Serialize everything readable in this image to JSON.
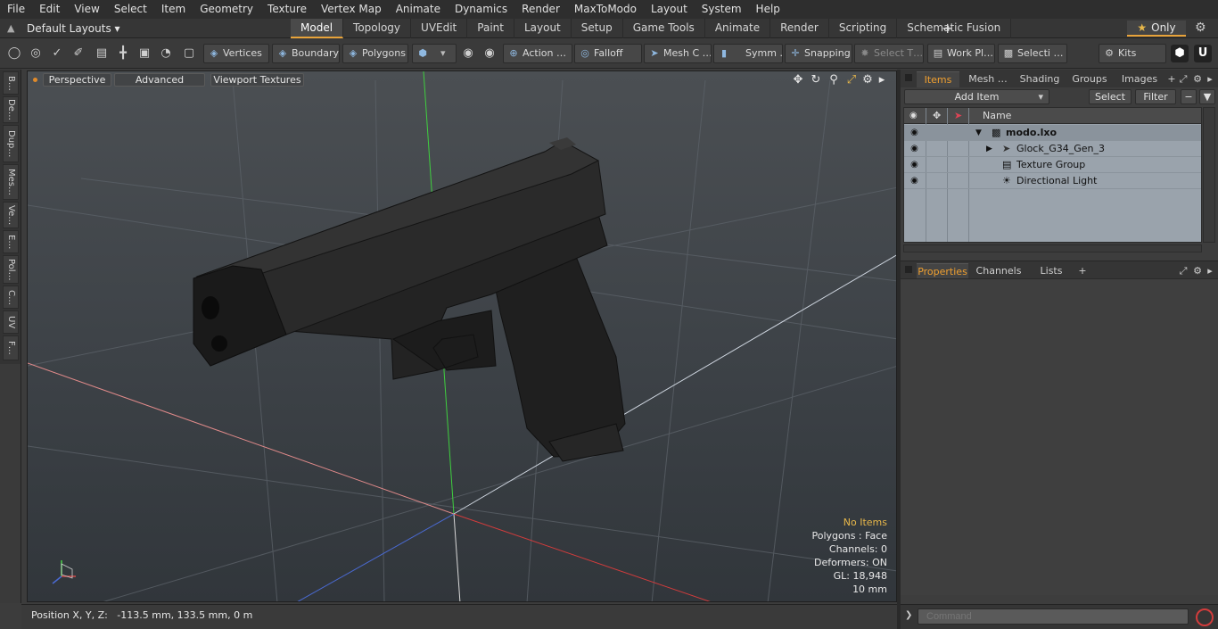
{
  "menu": [
    "File",
    "Edit",
    "View",
    "Select",
    "Item",
    "Geometry",
    "Texture",
    "Vertex Map",
    "Animate",
    "Dynamics",
    "Render",
    "MaxToModo",
    "Layout",
    "System",
    "Help"
  ],
  "layouts": {
    "label": "Default Layouts ▾"
  },
  "mode_tabs": [
    {
      "label": "Model",
      "active": true
    },
    {
      "label": "Topology"
    },
    {
      "label": "UVEdit"
    },
    {
      "label": "Paint"
    },
    {
      "label": "Layout"
    },
    {
      "label": "Setup"
    },
    {
      "label": "Game Tools"
    },
    {
      "label": "Animate"
    },
    {
      "label": "Render"
    },
    {
      "label": "Scripting"
    },
    {
      "label": "Schematic Fusion"
    }
  ],
  "add_tab": "+",
  "only_label": "Only",
  "toolbar": {
    "vertices": "Vertices",
    "boundary": "Boundary",
    "polygons": "Polygons",
    "action": "Action  …",
    "falloff": "Falloff",
    "mesh_c": "Mesh C …",
    "symm": "Symm …",
    "snapping": "Snapping",
    "select_t": "Select T…",
    "work_pl": "Work Pl…",
    "selecti": "Selecti …",
    "kits": "Kits"
  },
  "left_tabs": [
    "B…",
    "De…",
    "Dup…",
    "Mes…",
    "Ve…",
    "E…",
    "Pol…",
    "C…",
    "UV",
    "F…"
  ],
  "viewport": {
    "perspective": "Perspective",
    "advanced": "Advanced",
    "viewport_textures": "Viewport Textures",
    "info": {
      "no_items": "No Items",
      "polygons": "Polygons : Face",
      "channels": "Channels: 0",
      "deformers": "Deformers: ON",
      "gl": "GL: 18,948",
      "scale": "10 mm"
    }
  },
  "position_bar": "Position X, Y, Z:   -113.5 mm, 133.5 mm, 0 m",
  "right_panel": {
    "tabs": [
      {
        "label": "Items",
        "active": true
      },
      {
        "label": "Mesh …"
      },
      {
        "label": "Shading"
      },
      {
        "label": "Groups"
      },
      {
        "label": "Images"
      }
    ],
    "add_item": "Add Item",
    "select": "Select",
    "filter": "Filter",
    "name_header": "Name",
    "items": [
      {
        "name": "modo.lxo",
        "bold": true
      },
      {
        "name": "Glock_G34_Gen_3"
      },
      {
        "name": "Texture Group"
      },
      {
        "name": "Directional Light"
      }
    ],
    "props_tabs": [
      {
        "label": "Properties",
        "active": true
      },
      {
        "label": "Channels"
      },
      {
        "label": "Lists"
      }
    ],
    "add_props_tab": "+"
  },
  "command": {
    "placeholder": "Command"
  },
  "colors": {
    "accent": "#e8a33a",
    "x_axis": "#d24a4a",
    "y_axis": "#4ad24a",
    "z_axis": "#4a6ad2"
  }
}
